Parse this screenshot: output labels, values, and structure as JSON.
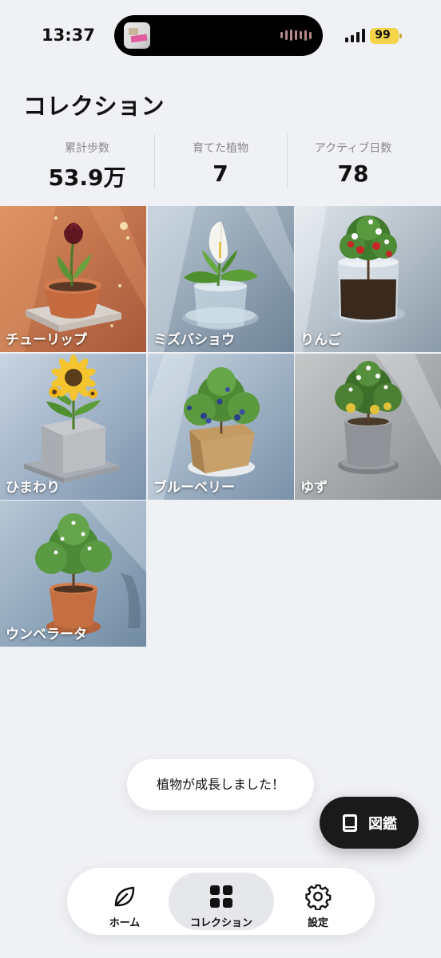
{
  "status_bar": {
    "time": "13:37",
    "battery": "99",
    "battery_color": "#f5d449"
  },
  "page": {
    "title": "コレクション"
  },
  "stats": [
    {
      "label": "累計歩数",
      "value": "53.9万"
    },
    {
      "label": "育てた植物",
      "value": "7"
    },
    {
      "label": "アクティブ日数",
      "value": "78"
    }
  ],
  "plants": [
    {
      "name": "チューリップ",
      "icon": "tulip"
    },
    {
      "name": "ミズバショウ",
      "icon": "calla-lily"
    },
    {
      "name": "りんご",
      "icon": "apple-tree"
    },
    {
      "name": "ひまわり",
      "icon": "sunflower"
    },
    {
      "name": "ブルーベリー",
      "icon": "blueberry"
    },
    {
      "name": "ゆず",
      "icon": "yuzu"
    },
    {
      "name": "ウンベラータ",
      "icon": "umbellata"
    }
  ],
  "toast": {
    "message": "植物が成長しました！"
  },
  "fab": {
    "label": "図鑑",
    "icon": "book-icon"
  },
  "bottom_nav": {
    "items": [
      {
        "label": "ホーム",
        "icon": "leaf-icon"
      },
      {
        "label": "コレクション",
        "icon": "grid-icon",
        "active": true
      },
      {
        "label": "設定",
        "icon": "gear-icon"
      }
    ]
  },
  "colors": {
    "background": "#f0f1f5",
    "accent_dark": "#1a1a1a"
  }
}
